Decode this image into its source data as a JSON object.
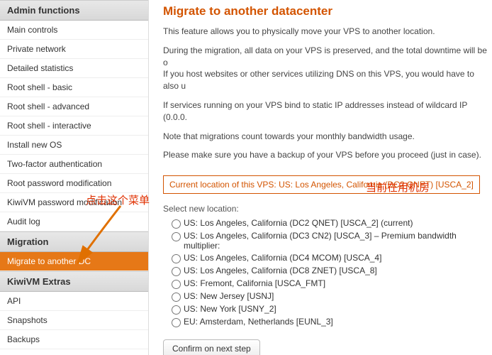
{
  "sidebar": {
    "sections": [
      {
        "title": "Admin functions",
        "items": [
          {
            "label": "Main controls",
            "active": false
          },
          {
            "label": "Private network",
            "active": false
          },
          {
            "label": "Detailed statistics",
            "active": false
          },
          {
            "label": "Root shell - basic",
            "active": false
          },
          {
            "label": "Root shell - advanced",
            "active": false
          },
          {
            "label": "Root shell - interactive",
            "active": false
          },
          {
            "label": "Install new OS",
            "active": false
          },
          {
            "label": "Two-factor authentication",
            "active": false
          },
          {
            "label": "Root password modification",
            "active": false
          },
          {
            "label": "KiwiVM password modification",
            "active": false
          },
          {
            "label": "Audit log",
            "active": false
          }
        ]
      },
      {
        "title": "Migration",
        "items": [
          {
            "label": "Migrate to another DC",
            "active": true
          }
        ]
      },
      {
        "title": "KiwiVM Extras",
        "items": [
          {
            "label": "API",
            "active": false
          },
          {
            "label": "Snapshots",
            "active": false
          },
          {
            "label": "Backups",
            "active": false
          }
        ]
      }
    ]
  },
  "main": {
    "title": "Migrate to another datacenter",
    "paragraphs": [
      "This feature allows you to physically move your VPS to another location.",
      "During the migration, all data on your VPS is preserved, and the total downtime will be o",
      "If you host websites or other services utilizing DNS on this VPS, you would have to also u",
      "If services running on your VPS bind to static IP addresses instead of wildcard IP (0.0.0.",
      "Note that migrations count towards your monthly bandwidth usage.",
      "Please make sure you have a backup of your VPS before you proceed (just in case)."
    ],
    "current_location": "Current location of this VPS: US: Los Angeles, California (DC2 QNET) [USCA_2]",
    "select_label": "Select new location:",
    "locations": [
      "US: Los Angeles, California (DC2 QNET) [USCA_2] (current)",
      "US: Los Angeles, California (DC3 CN2) [USCA_3] – Premium bandwidth multiplier:",
      "US: Los Angeles, California (DC4 MCOM) [USCA_4]",
      "US: Los Angeles, California (DC8 ZNET) [USCA_8]",
      "US: Fremont, California [USCA_FMT]",
      "US: New Jersey [USNJ]",
      "US: New York [USNY_2]",
      "EU: Amsterdam, Netherlands [EUNL_3]"
    ],
    "confirm_button": "Confirm on next step"
  },
  "annotations": {
    "click_menu": "点击这个菜单",
    "current_dc": "当前在用机房"
  }
}
